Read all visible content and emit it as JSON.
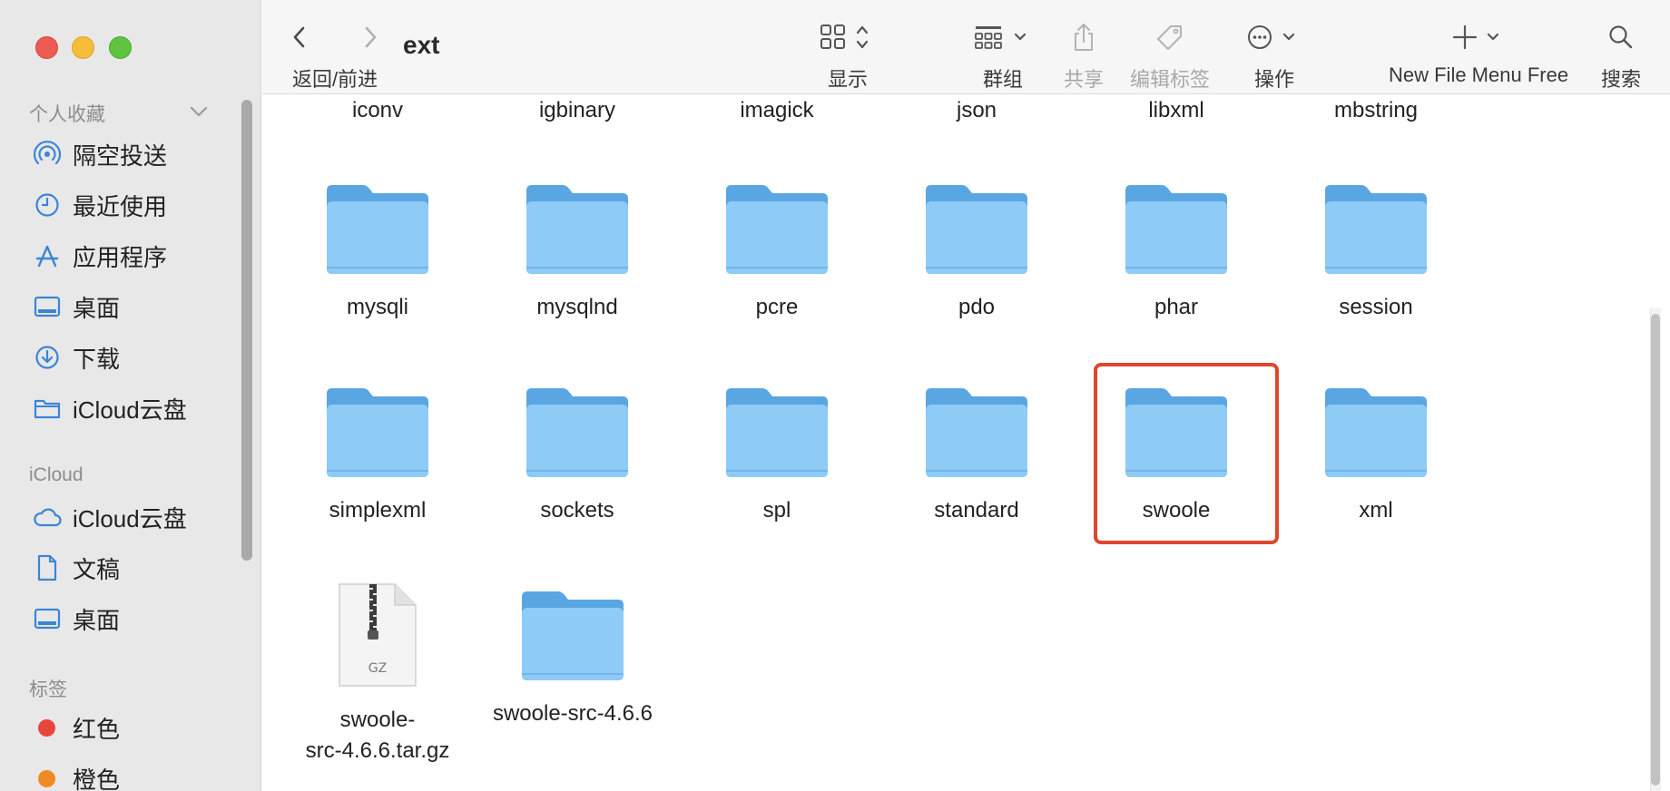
{
  "window": {
    "title": "ext"
  },
  "toolbar": {
    "back_forward_label": "返回/前进",
    "view_label": "显示",
    "group_label": "群组",
    "share_label": "共享",
    "tags_label": "编辑标签",
    "action_label": "操作",
    "new_file_label": "New File Menu Free",
    "search_label": "搜索"
  },
  "sidebar": {
    "favorites_header": "个人收藏",
    "favorites": [
      {
        "label": "隔空投送",
        "icon": "airdrop-icon"
      },
      {
        "label": "最近使用",
        "icon": "clock-icon"
      },
      {
        "label": "应用程序",
        "icon": "applications-icon"
      },
      {
        "label": "桌面",
        "icon": "desktop-icon"
      },
      {
        "label": "下载",
        "icon": "download-icon"
      },
      {
        "label": "iCloud云盘",
        "icon": "folder-icon"
      }
    ],
    "icloud_header": "iCloud",
    "icloud": [
      {
        "label": "iCloud云盘",
        "icon": "cloud-icon"
      },
      {
        "label": "文稿",
        "icon": "document-icon"
      },
      {
        "label": "桌面",
        "icon": "desktop-icon"
      }
    ],
    "tags_header": "标签",
    "tags": [
      {
        "label": "红色",
        "color": "#e8463c"
      },
      {
        "label": "橙色",
        "color": "#f08a24"
      }
    ]
  },
  "files": {
    "row0": [
      "iconv",
      "igbinary",
      "imagick",
      "json",
      "libxml",
      "mbstring"
    ],
    "row1": [
      "mysqli",
      "mysqlnd",
      "pcre",
      "pdo",
      "phar",
      "session"
    ],
    "row2": [
      "simplexml",
      "sockets",
      "spl",
      "standard",
      "swoole",
      "xml"
    ],
    "archive": {
      "name_line1": "swoole-",
      "name_line2": "src-4.6.6.tar.gz",
      "badge": "GZ"
    },
    "folder_last": "swoole-src-4.6.6"
  },
  "colors": {
    "accent": "#3a85d6",
    "highlight": "#e0452e",
    "folder_body": "#8ecbf7",
    "folder_tab": "#5aa6e2"
  }
}
